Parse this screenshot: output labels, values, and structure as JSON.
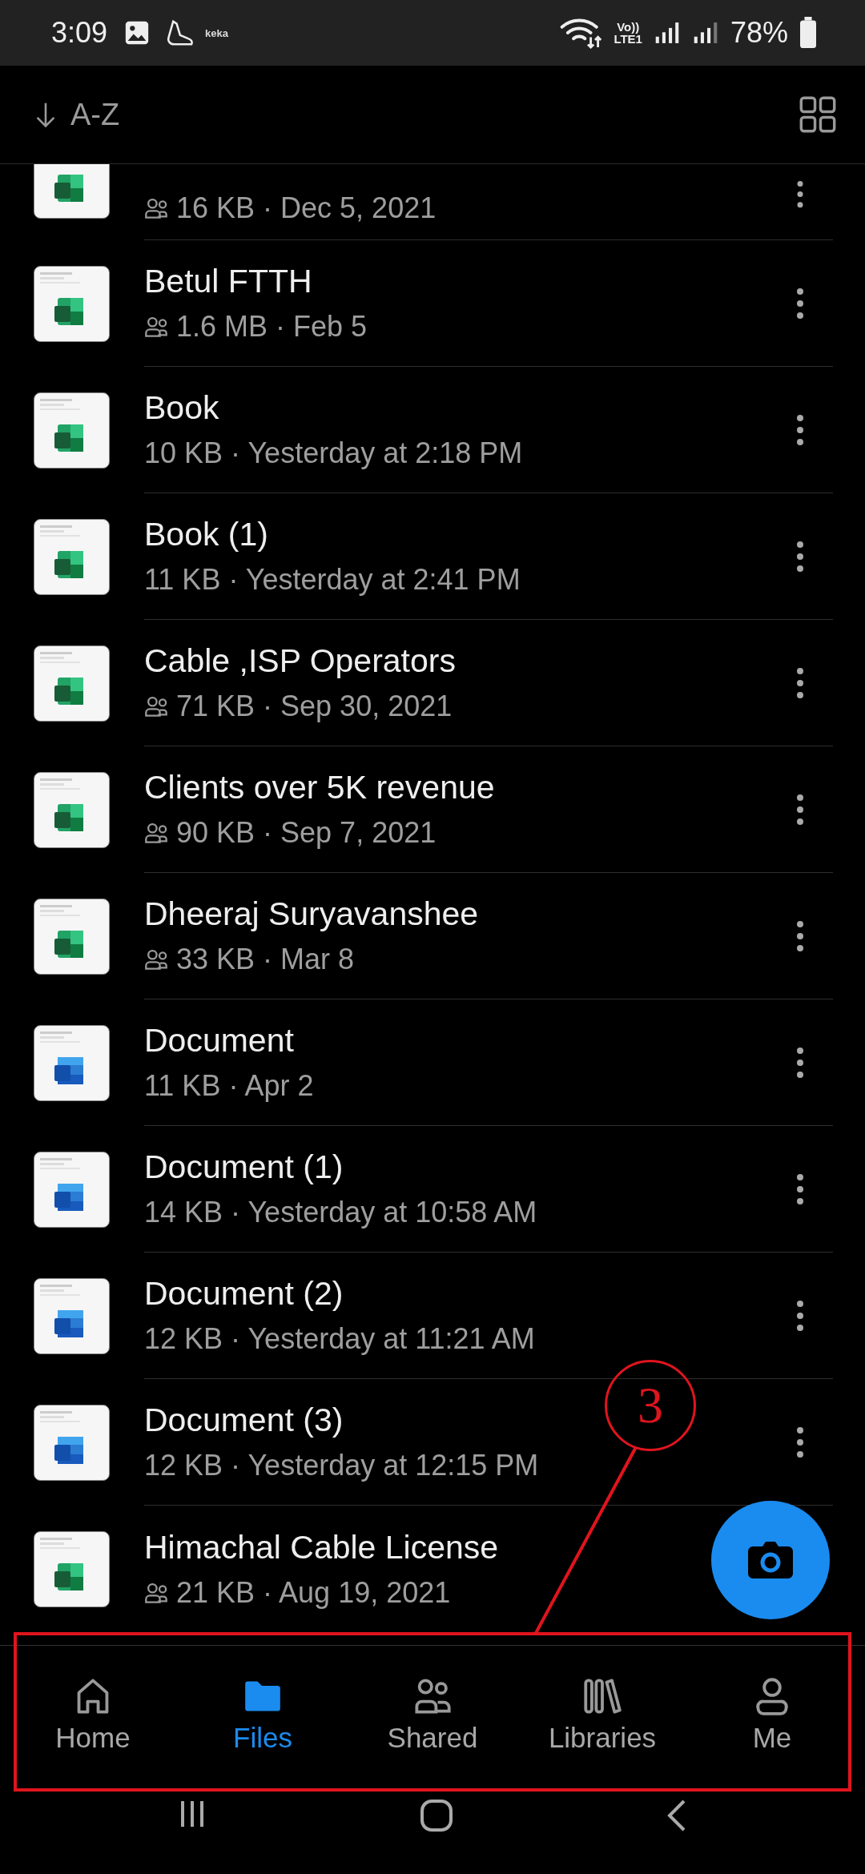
{
  "status_bar": {
    "time": "3:09",
    "app_badge": "keka",
    "network_top": "Vo))",
    "network_bottom": "LTE1",
    "battery": "78%"
  },
  "toolbar": {
    "sort_label": "A-Z"
  },
  "files": [
    {
      "kind": "excel",
      "cut": true,
      "shared": true,
      "meta": "16 KB · Dec 5, 2021"
    },
    {
      "kind": "excel",
      "cut": false,
      "title": "Betul FTTH",
      "shared": true,
      "meta": "1.6 MB · Feb 5"
    },
    {
      "kind": "excel",
      "cut": false,
      "title": "Book",
      "shared": false,
      "meta": "10 KB · Yesterday at 2:18 PM"
    },
    {
      "kind": "excel",
      "cut": false,
      "title": "Book (1)",
      "shared": false,
      "meta": "11 KB · Yesterday at 2:41 PM"
    },
    {
      "kind": "excel",
      "cut": false,
      "title": "Cable ,ISP Operators",
      "shared": true,
      "meta": "71 KB · Sep 30, 2021"
    },
    {
      "kind": "excel",
      "cut": false,
      "title": "Clients over 5K revenue",
      "shared": true,
      "meta": "90 KB · Sep 7, 2021"
    },
    {
      "kind": "excel",
      "cut": false,
      "title": "Dheeraj Suryavanshee",
      "shared": true,
      "meta": "33 KB · Mar 8"
    },
    {
      "kind": "word",
      "cut": false,
      "title": "Document",
      "shared": false,
      "meta": "11 KB · Apr 2"
    },
    {
      "kind": "word",
      "cut": false,
      "title": "Document (1)",
      "shared": false,
      "meta": "14 KB · Yesterday at 10:58 AM"
    },
    {
      "kind": "word",
      "cut": false,
      "title": "Document (2)",
      "shared": false,
      "meta": "12 KB · Yesterday at 11:21 AM"
    },
    {
      "kind": "word",
      "cut": false,
      "title": "Document (3)",
      "shared": false,
      "meta": "12 KB · Yesterday at 12:15 PM"
    },
    {
      "kind": "excel",
      "cut": false,
      "title": "Himachal Cable License",
      "shared": true,
      "meta": "21 KB · Aug 19, 2021"
    }
  ],
  "bottom_nav": [
    {
      "kind": "home",
      "label": "Home",
      "selected": false
    },
    {
      "kind": "files",
      "label": "Files",
      "selected": true
    },
    {
      "kind": "shared",
      "label": "Shared",
      "selected": false
    },
    {
      "kind": "libraries",
      "label": "Libraries",
      "selected": false
    },
    {
      "kind": "me",
      "label": "Me",
      "selected": false
    }
  ],
  "annotation": {
    "label": "3"
  }
}
